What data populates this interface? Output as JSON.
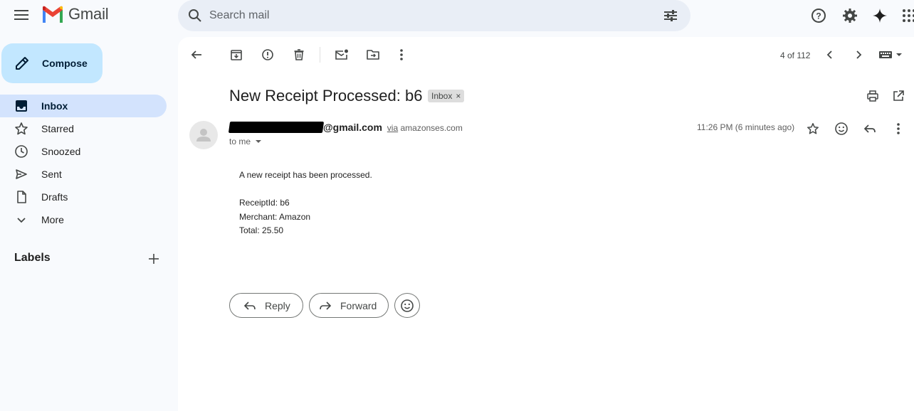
{
  "app": {
    "name": "Gmail"
  },
  "search": {
    "placeholder": "Search mail"
  },
  "compose": {
    "label": "Compose"
  },
  "sidebar": {
    "items": [
      {
        "label": "Inbox",
        "icon": "inbox-icon",
        "active": true
      },
      {
        "label": "Starred",
        "icon": "star-icon"
      },
      {
        "label": "Snoozed",
        "icon": "clock-icon"
      },
      {
        "label": "Sent",
        "icon": "send-icon"
      },
      {
        "label": "Drafts",
        "icon": "draft-icon"
      },
      {
        "label": "More",
        "icon": "chevron-down-icon"
      }
    ],
    "labels_title": "Labels"
  },
  "toolbar": {
    "pager": "4 of 112"
  },
  "message": {
    "subject": "New Receipt Processed: b6",
    "label_chip": "Inbox",
    "chip_close": "×",
    "sender_domain": "@gmail.com",
    "via": "via",
    "via_domain": "amazonses.com",
    "to": "to me",
    "time": "11:26 PM (6 minutes ago)",
    "body_lines": [
      "A new receipt has been processed.",
      "ReceiptId: b6",
      "Merchant: Amazon",
      "Total: 25.50"
    ]
  },
  "actions": {
    "reply": "Reply",
    "forward": "Forward"
  },
  "colors": {
    "accent": "#c2e7ff",
    "active_nav": "#d3e3fd",
    "search_bg": "#e9eef6",
    "gmail_red": "#ea4335",
    "gmail_blue": "#4285f4",
    "gmail_green": "#34a853",
    "gmail_yellow": "#fbbc04"
  }
}
